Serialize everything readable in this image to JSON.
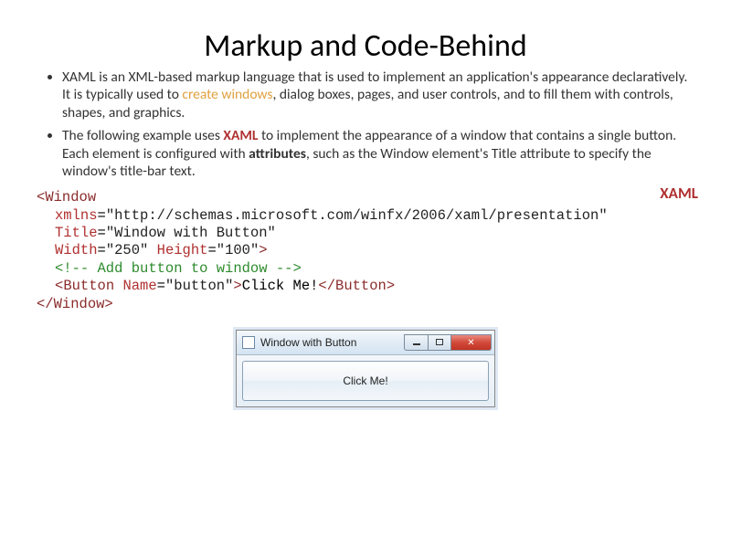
{
  "title": "Markup and Code-Behind",
  "bullets": {
    "b1_pre": "XAML is an XML-based markup language that is used to implement an application's appearance declaratively. It is typically used to ",
    "b1_link": "create windows",
    "b1_post": ", dialog boxes, pages, and user controls, and to fill them with controls, shapes, and graphics.",
    "b2_pre": "The following example uses ",
    "b2_xaml": "XAML",
    "b2_mid": " to implement the appearance of a window that contains a single button. Each element is configured with ",
    "b2_attr": "attributes",
    "b2_post": ", such as the Window element's Title attribute to specify the window's title-bar text."
  },
  "code": {
    "label": "XAML",
    "l1_open": "<",
    "l1_tag": "Window",
    "l2_attr": "xmlns",
    "l2_eq": "=",
    "l2_val": "\"http://schemas.microsoft.com/winfx/2006/xaml/presentation\"",
    "l3_attr": "Title",
    "l3_eq": "=",
    "l3_val": "\"Window with Button\"",
    "l4_attr1": "Width",
    "l4_eq1": "=",
    "l4_val1": "\"250\"",
    "l4_sp": " ",
    "l4_attr2": "Height",
    "l4_eq2": "=",
    "l4_val2": "\"100\"",
    "l4_close": ">",
    "l5_comment": "<!-- Add button to window -->",
    "l6_open": "<",
    "l6_tag": "Button",
    "l6_sp": " ",
    "l6_attr": "Name",
    "l6_eq": "=",
    "l6_val": "\"button\"",
    "l6_gt": ">",
    "l6_text": "Click Me!",
    "l6_close_open": "</",
    "l6_close_tag": "Button",
    "l6_close_gt": ">",
    "l7_open": "</",
    "l7_tag": "Window",
    "l7_close": ">"
  },
  "window": {
    "title": "Window with Button",
    "button_label": "Click Me!",
    "close_glyph": "✕"
  }
}
